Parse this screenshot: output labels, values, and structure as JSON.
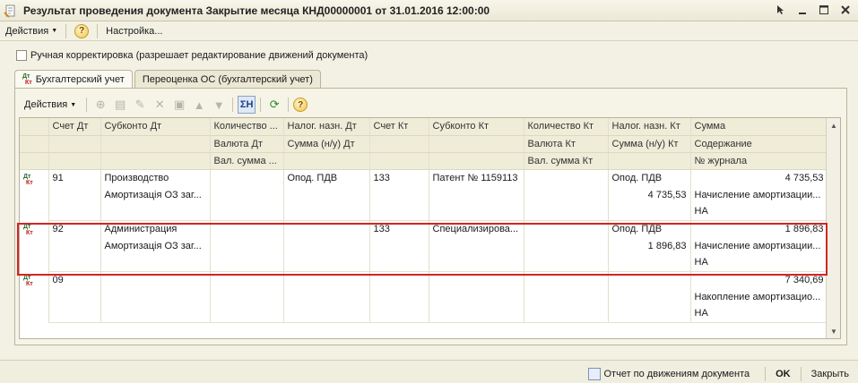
{
  "window": {
    "title": "Результат проведения документа Закрытие месяца КНД00000001 от 31.01.2016 12:00:00"
  },
  "menu": {
    "actions_label": "Действия",
    "settings_label": "Настройка..."
  },
  "options": {
    "manual_adjust_label": "Ручная корректировка (разрешает редактирование движений документа)"
  },
  "tabs": [
    {
      "label": "Бухгалтерский учет",
      "active": true
    },
    {
      "label": "Переоценка ОС (бухгалтерский учет)",
      "active": false
    }
  ],
  "toolbar": {
    "actions_label": "Действия",
    "sum_label": "ΣН",
    "help_label": "?"
  },
  "table": {
    "headers": {
      "r1": [
        "Счет Дт",
        "Субконто Дт",
        "Количество ...",
        "Налог. назн. Дт",
        "Счет Кт",
        "Субконто Кт",
        "Количество Кт",
        "Налог. назн. Кт",
        "Сумма"
      ],
      "r2": [
        "",
        "",
        "Валюта Дт",
        "Сумма (н/у) Дт",
        "",
        "",
        "Валюта Кт",
        "Сумма (н/у) Кт",
        "Содержание"
      ],
      "r3": [
        "",
        "",
        "Вал. сумма ...",
        "",
        "",
        "",
        "Вал. сумма Кт",
        "",
        "№ журнала"
      ]
    },
    "records": [
      {
        "r1": [
          "91",
          "Производство",
          "",
          "Опод. ПДВ",
          "133",
          "Патент № 1159113",
          "",
          "Опод. ПДВ",
          "4 735,53"
        ],
        "r2": [
          "",
          "Амортизація ОЗ заг...",
          "",
          "",
          "",
          "",
          "",
          "4 735,53",
          "Начисление амортизации..."
        ],
        "r3": [
          "",
          "",
          "",
          "",
          "",
          "",
          "",
          "",
          "НА"
        ]
      },
      {
        "r1": [
          "92",
          "Администрация",
          "",
          "",
          "133",
          "Специализирова...",
          "",
          "Опод. ПДВ",
          "1 896,83"
        ],
        "r2": [
          "",
          "Амортизація ОЗ заг...",
          "",
          "",
          "",
          "",
          "",
          "1 896,83",
          "Начисление амортизации..."
        ],
        "r3": [
          "",
          "",
          "",
          "",
          "",
          "",
          "",
          "",
          "НА"
        ]
      },
      {
        "r1": [
          "09",
          "",
          "",
          "",
          "",
          "",
          "",
          "",
          "7 340,69"
        ],
        "r2": [
          "",
          "",
          "",
          "",
          "",
          "",
          "",
          "",
          "Накопление амортизацио..."
        ],
        "r3": [
          "",
          "",
          "",
          "",
          "",
          "",
          "",
          "",
          "НА"
        ]
      }
    ]
  },
  "status": {
    "report_label": "Отчет по движениям документа",
    "ok_label": "OK",
    "close_label": "Закрыть"
  }
}
